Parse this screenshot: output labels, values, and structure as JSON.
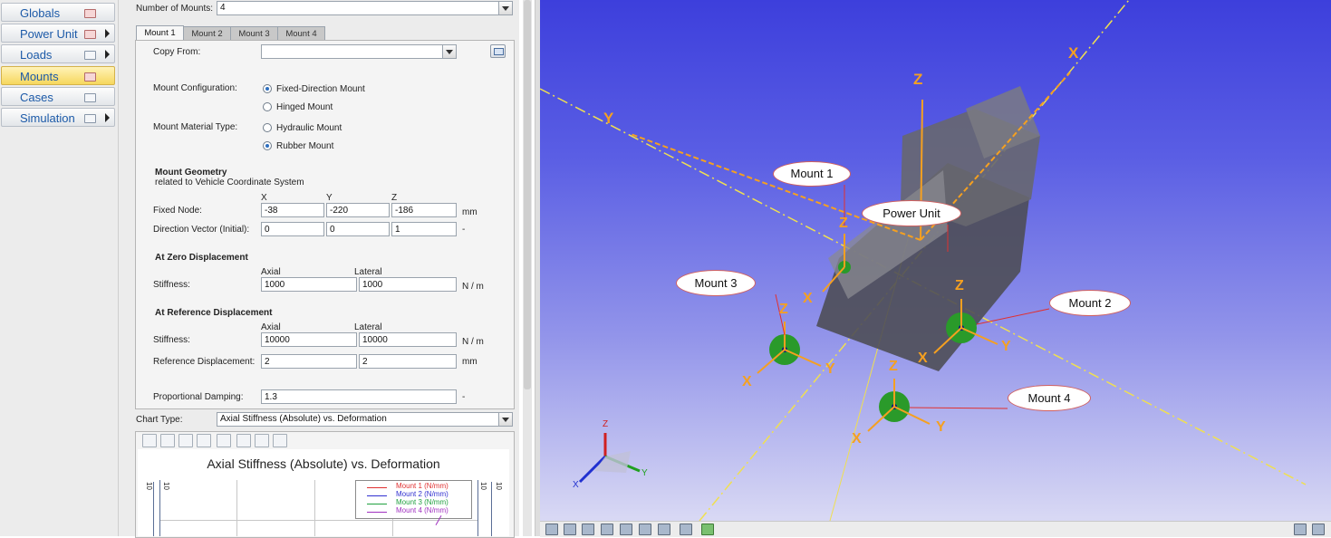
{
  "nav": {
    "items": [
      {
        "label": "Globals",
        "icon": "globals-icon",
        "arrow": false,
        "active": false
      },
      {
        "label": "Power Unit",
        "icon": "power-unit-icon",
        "arrow": true,
        "active": false
      },
      {
        "label": "Loads",
        "icon": "loads-icon",
        "arrow": true,
        "active": false
      },
      {
        "label": "Mounts",
        "icon": "mounts-icon",
        "arrow": false,
        "active": true
      },
      {
        "label": "Cases",
        "icon": "cases-icon",
        "arrow": false,
        "active": false
      },
      {
        "label": "Simulation",
        "icon": "simulation-icon",
        "arrow": true,
        "active": false
      }
    ]
  },
  "form": {
    "num_mounts_label": "Number of Mounts:",
    "num_mounts_value": "4",
    "tabs": [
      "Mount 1",
      "Mount 2",
      "Mount 3",
      "Mount 4"
    ],
    "active_tab": "Mount 1",
    "copy_from_label": "Copy From:",
    "copy_from_value": "",
    "config_label": "Mount Configuration:",
    "config_options": [
      "Fixed-Direction Mount",
      "Hinged Mount"
    ],
    "config_selected": "Fixed-Direction Mount",
    "material_label": "Mount Material Type:",
    "material_options": [
      "Hydraulic Mount",
      "Rubber Mount"
    ],
    "material_selected": "Rubber Mount",
    "geometry_title": "Mount Geometry",
    "geometry_subtitle": "related to Vehicle Coordinate System",
    "col_x": "X",
    "col_y": "Y",
    "col_z": "Z",
    "fixed_node_label": "Fixed Node:",
    "fixed_node": [
      "-38",
      "-220",
      "-186"
    ],
    "fixed_node_unit": "mm",
    "direction_label": "Direction Vector (Initial):",
    "direction": [
      "0",
      "0",
      "1"
    ],
    "direction_unit": "-",
    "zero_disp_title": "At Zero Displacement",
    "col_axial": "Axial",
    "col_lateral": "Lateral",
    "stiffness_label": "Stiffness:",
    "zero_stiffness": [
      "1000",
      "1000"
    ],
    "stiffness_unit": "N / m",
    "ref_disp_title": "At Reference Displacement",
    "ref_stiffness": [
      "10000",
      "10000"
    ],
    "ref_disp_label": "Reference Displacement:",
    "ref_disp": [
      "2",
      "2"
    ],
    "ref_disp_unit": "mm",
    "damping_label": "Proportional Damping:",
    "damping_value": "1.3",
    "damping_unit": "-"
  },
  "chart": {
    "type_label": "Chart Type:",
    "type_value": "Axial Stiffness (Absolute) vs. Deformation",
    "title": "Axial Stiffness (Absolute) vs. Deformation",
    "axis_tick": "10",
    "legend": [
      {
        "name": "Mount 1 (N/mm)",
        "color": "#e03030"
      },
      {
        "name": "Mount 2 (N/mm)",
        "color": "#3030d0"
      },
      {
        "name": "Mount 3 (N/mm)",
        "color": "#20a040"
      },
      {
        "name": "Mount 4 (N/mm)",
        "color": "#a030c0"
      }
    ]
  },
  "viewport": {
    "callouts": [
      "Mount 1",
      "Power Unit",
      "Mount 3",
      "Mount 2",
      "Mount 4"
    ],
    "axis_x": "X",
    "axis_y": "Y",
    "axis_z": "Z",
    "colors": {
      "axis": "#f5a020",
      "guide": "#f0e050",
      "mount": "#2a9a2a",
      "body": "#5a5a62"
    }
  }
}
